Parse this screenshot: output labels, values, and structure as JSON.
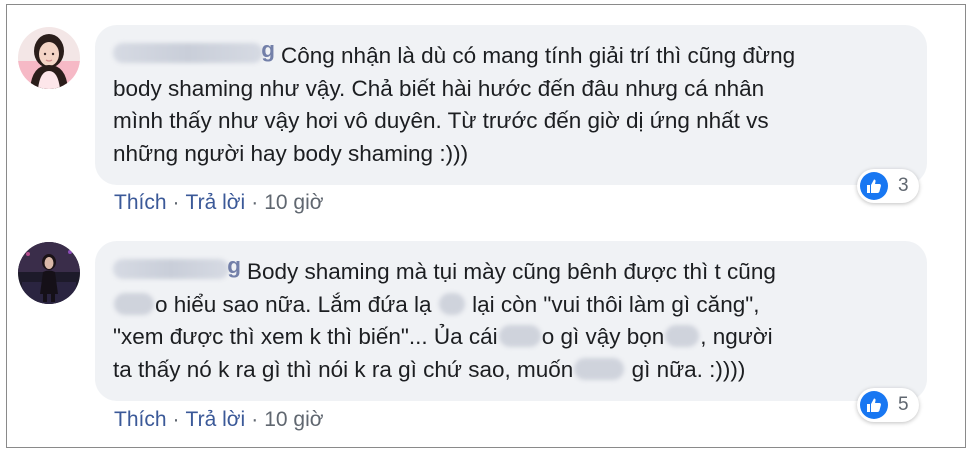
{
  "comments": [
    {
      "author_tail": "g",
      "lines": [
        "Công nhận là dù có mang tính giải trí thì cũng đừng",
        "body shaming như vậy. Chả biết hài hước đến đâu nhưg cá nhân",
        "mình thấy như vậy hơi vô duyên. Từ trước đến giờ dị ứng nhất vs",
        "những người hay body shaming :)))"
      ],
      "like_label": "Thích",
      "reply_label": "Trả lời",
      "separator": "·",
      "time": "10 giờ",
      "reaction_icon": "like-icon",
      "reaction_count": "3"
    },
    {
      "author_tail": "g",
      "line1": "Body shaming mà tụi mày cũng bênh được thì t cũng",
      "line2_a": "o hiểu sao nữa. Lắm đứa lạ",
      "line2_b": "lại còn \"vui thôi làm gì căng\",",
      "line3_a": "\"xem được thì xem k thì biến\"... Ủa cái",
      "line3_b": "o gì vậy bọn",
      "line3_c": ", người",
      "line4_a": "ta thấy nó k ra gì thì nói k ra gì chứ sao, muốn",
      "line4_b": "gì nữa. :))))",
      "like_label": "Thích",
      "reply_label": "Trả lời",
      "separator": "·",
      "time": "10 giờ",
      "reaction_icon": "like-icon",
      "reaction_count": "5"
    }
  ],
  "colors": {
    "link": "#3b5998",
    "bubble": "#f0f2f5",
    "like_blue": "#1877f2",
    "text": "#1c1e21",
    "meta": "#606770"
  }
}
